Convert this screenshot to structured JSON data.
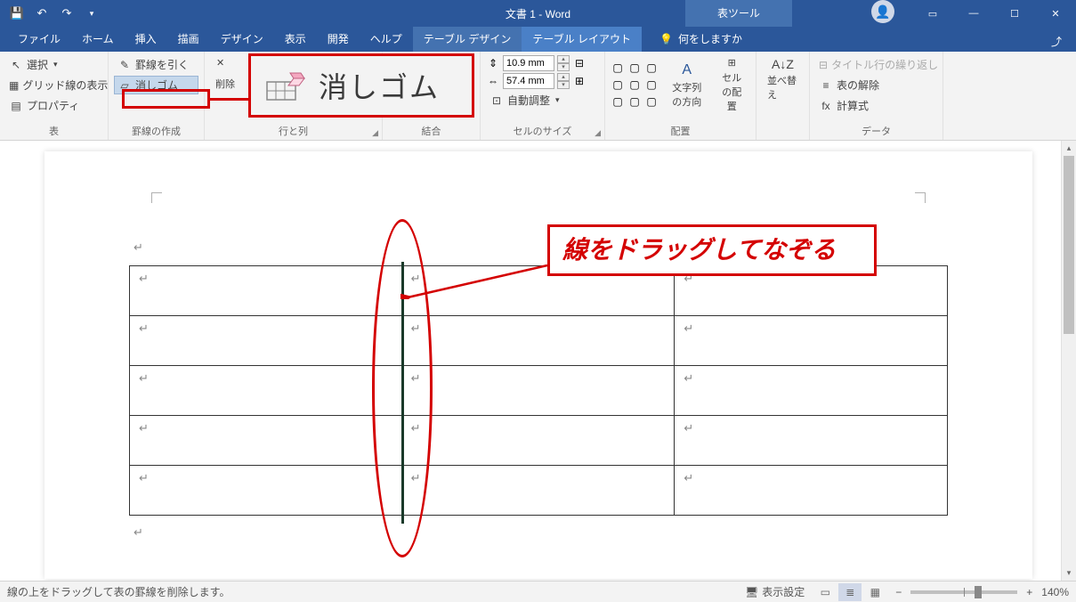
{
  "titlebar": {
    "doc_title": "文書 1 - Word",
    "tools_title": "表ツール"
  },
  "tabs": {
    "file": "ファイル",
    "home": "ホーム",
    "insert": "挿入",
    "draw": "描画",
    "design": "デザイン",
    "view": "表示",
    "dev": "開発",
    "help": "ヘルプ",
    "table_design": "テーブル デザイン",
    "table_layout": "テーブル レイアウト",
    "tell_me": "何をしますか"
  },
  "ribbon": {
    "group_table": {
      "label": "表",
      "select": "選択",
      "gridlines": "グリッド線の表示",
      "properties": "プロパティ"
    },
    "group_draw": {
      "label": "罫線の作成",
      "draw": "罫線を引く",
      "eraser": "消しゴム"
    },
    "group_rowcol": {
      "label": "行と列",
      "delete": "削除"
    },
    "group_merge": {
      "label": "結合"
    },
    "group_size": {
      "label": "セルのサイズ",
      "height": "10.9 mm",
      "width": "57.4 mm",
      "autofit": "自動調整"
    },
    "group_align": {
      "label": "配置",
      "text_dir": "文字列の方向",
      "margins": "セルの配置"
    },
    "group_data": {
      "label": "データ",
      "sort": "並べ替え",
      "repeat_header": "タイトル行の繰り返し",
      "convert": "表の解除",
      "formula": "計算式"
    }
  },
  "callout": {
    "big_eraser_label": "消しゴム"
  },
  "annotation": {
    "drag_text": "線をドラッグしてなぞる"
  },
  "statusbar": {
    "message": "線の上をドラッグして表の罫線を削除します。",
    "display_settings": "表示設定",
    "zoom": "140%"
  }
}
